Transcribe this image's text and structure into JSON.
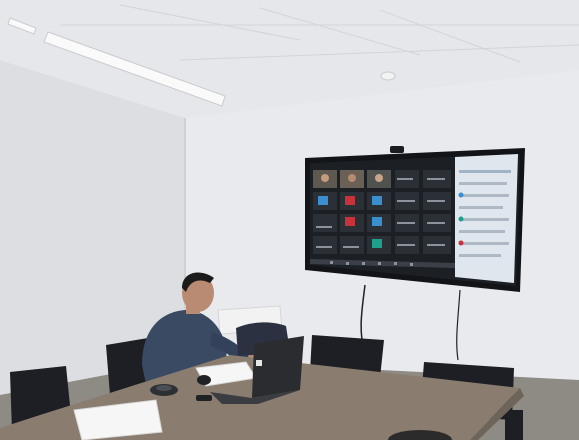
{
  "scene": {
    "caption": "",
    "palette": {
      "ceiling": "#e6e7ea",
      "wall_left": "#dcdee2",
      "wall_back": "#e9eaed",
      "floor": "#8e8a84",
      "table": "#8a7d6f",
      "table_edge": "#6f6459",
      "chair": "#1d1f24",
      "screen_bezel": "#121418",
      "screen_bg": "#1c2025",
      "panel_bg": "#dfe6ee",
      "shirt": "#3a4a63",
      "skin": "#b88b72",
      "hair": "#1b1b1b",
      "laptop": "#2a2c30",
      "paper": "#f6f6f6",
      "tile_accent_blue": "#3a8fd0",
      "tile_accent_red": "#c8323a",
      "tile_accent_teal": "#1ea08c"
    },
    "objects": [
      {
        "name": "ceiling",
        "label": ""
      },
      {
        "name": "ceiling-light",
        "label": ""
      },
      {
        "name": "smoke-detector",
        "label": ""
      },
      {
        "name": "wall-tv-display",
        "label": ""
      },
      {
        "name": "webcam",
        "label": ""
      },
      {
        "name": "video-call-grid",
        "label": ""
      },
      {
        "name": "participants-panel",
        "label": ""
      },
      {
        "name": "conference-table",
        "label": ""
      },
      {
        "name": "seated-person",
        "label": ""
      },
      {
        "name": "laptop",
        "label": ""
      },
      {
        "name": "office-chairs",
        "label": ""
      },
      {
        "name": "paper-documents",
        "label": ""
      }
    ]
  }
}
